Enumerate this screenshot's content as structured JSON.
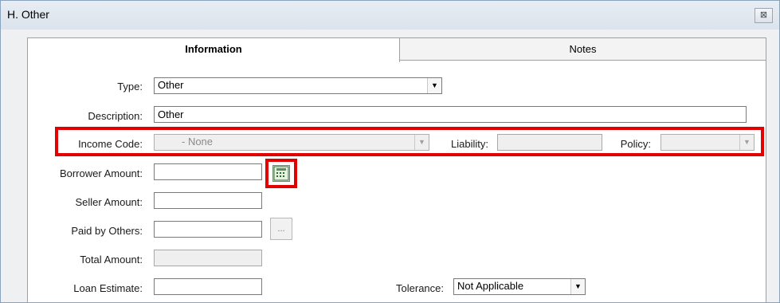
{
  "window": {
    "title": "H. Other",
    "close_glyph": "⊠"
  },
  "tabs": [
    {
      "label": "Information",
      "active": true
    },
    {
      "label": "Notes",
      "active": false
    }
  ],
  "form": {
    "type": {
      "label": "Type:",
      "value": "Other"
    },
    "description": {
      "label": "Description:",
      "value": "Other"
    },
    "income_code": {
      "label": "Income Code:",
      "value": "- None",
      "enabled": false
    },
    "liability": {
      "label": "Liability:",
      "value": ""
    },
    "policy": {
      "label": "Policy:",
      "value": "",
      "enabled": false
    },
    "borrower_amount": {
      "label": "Borrower Amount:",
      "value": ""
    },
    "seller_amount": {
      "label": "Seller Amount:",
      "value": ""
    },
    "paid_by_others": {
      "label": "Paid by Others:",
      "value": "",
      "button": "..."
    },
    "total_amount": {
      "label": "Total Amount:",
      "value": ""
    },
    "loan_estimate": {
      "label": "Loan Estimate:",
      "value": ""
    },
    "tolerance": {
      "label": "Tolerance:",
      "value": "Not Applicable"
    }
  },
  "colors": {
    "highlight": "#e30000",
    "window_border": "#8aa3bd"
  },
  "icons": {
    "calculator": "calculator-icon",
    "dropdown": "chevron-down-icon",
    "close": "close-icon"
  }
}
